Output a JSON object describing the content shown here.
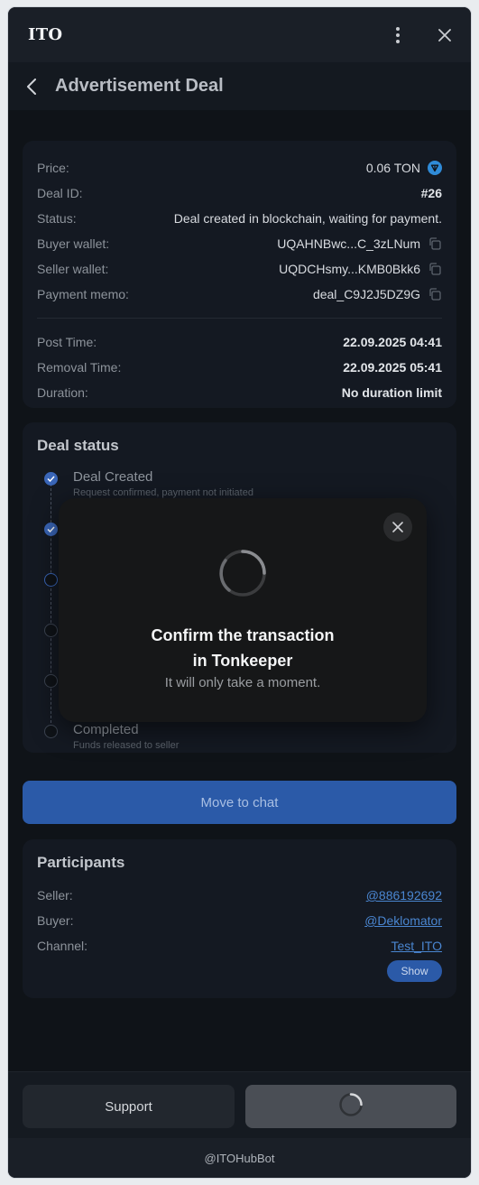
{
  "window": {
    "title": "ITO",
    "menu_icon": "more-vertical-icon",
    "close_icon": "close-icon"
  },
  "header": {
    "back_icon": "chevron-left-icon",
    "title": "Advertisement Deal"
  },
  "deal": {
    "rows": [
      {
        "label": "Price:",
        "value": "0.06 TON",
        "icon": "ton-icon"
      },
      {
        "label": "Deal ID:",
        "value": "#26"
      },
      {
        "label": "Status:",
        "value": "Deal created in blockchain, waiting for payment."
      },
      {
        "label": "Buyer wallet:",
        "value": "UQAHNBwc...C_3zLNum",
        "icon": "copy-icon"
      },
      {
        "label": "Seller wallet:",
        "value": "UQDCHsmy...KMB0Bkk6",
        "icon": "copy-icon"
      },
      {
        "label": "Payment memo:",
        "value": "deal_C9J2J5DZ9G",
        "icon": "copy-icon"
      }
    ],
    "times": [
      {
        "label": "Post Time:",
        "value": "22.09.2025 04:41"
      },
      {
        "label": "Removal Time:",
        "value": "22.09.2025 05:41"
      },
      {
        "label": "Duration:",
        "value": "No duration limit"
      }
    ]
  },
  "deal_status": {
    "title": "Deal status",
    "steps": [
      {
        "title": "Deal Created",
        "subtitle": "Request confirmed, payment not initiated",
        "state": "done"
      },
      {
        "title": "",
        "subtitle": "",
        "state": "done"
      },
      {
        "title": "",
        "subtitle": "",
        "state": "active"
      },
      {
        "title": "",
        "subtitle": "",
        "state": "pending"
      },
      {
        "title": "",
        "subtitle": "",
        "state": "pending"
      },
      {
        "title": "Completed",
        "subtitle": "Funds released to seller",
        "state": "pending"
      }
    ]
  },
  "chat_button": "Move to chat",
  "participants": {
    "title": "Participants",
    "rows": [
      {
        "label": "Seller:",
        "value": "@886192692"
      },
      {
        "label": "Buyer:",
        "value": "@Deklomator"
      },
      {
        "label": "Channel:",
        "value": "Test_ITO"
      }
    ],
    "show_button": "Show"
  },
  "modal": {
    "title_line1": "Confirm the transaction",
    "title_line2": "in Tonkeeper",
    "subtitle": "It will only take a moment.",
    "close_icon": "close-icon",
    "spinner_icon": "spinner-icon"
  },
  "footer": {
    "support_label": "Support",
    "pay_icon": "spinner-icon"
  },
  "bot_bar": "@ITOHubBot",
  "colors": {
    "accent": "#2b5aa8",
    "link": "#4a86d1",
    "background": "#0f1318",
    "card": "#141922",
    "ton": "#2f8bd8"
  }
}
